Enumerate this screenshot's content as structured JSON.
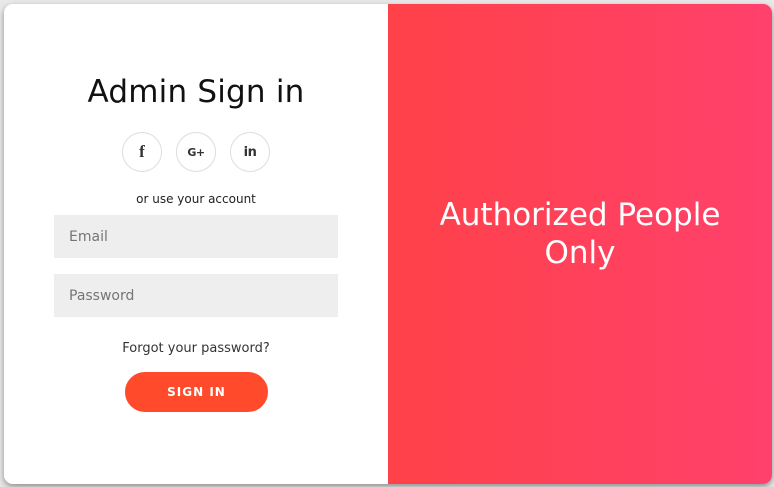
{
  "signin_panel": {
    "title": "Admin Sign in",
    "social_buttons": [
      {
        "glyph": "f",
        "icon": "facebook-icon"
      },
      {
        "glyph": "G+",
        "icon": "google-plus-icon"
      },
      {
        "glyph": "in",
        "icon": "linkedin-icon"
      }
    ],
    "alt_text": "or use your account",
    "email_placeholder": "Email",
    "password_placeholder": "Password",
    "forgot_link": "Forgot your password?",
    "submit_label": "SIGN IN"
  },
  "overlay_panel": {
    "headline": "Authorized People Only"
  },
  "colors": {
    "accent": "#ff4b2b",
    "gradient_start": "#ff4149",
    "gradient_end": "#ff416c",
    "input_bg": "#eeeeee"
  }
}
